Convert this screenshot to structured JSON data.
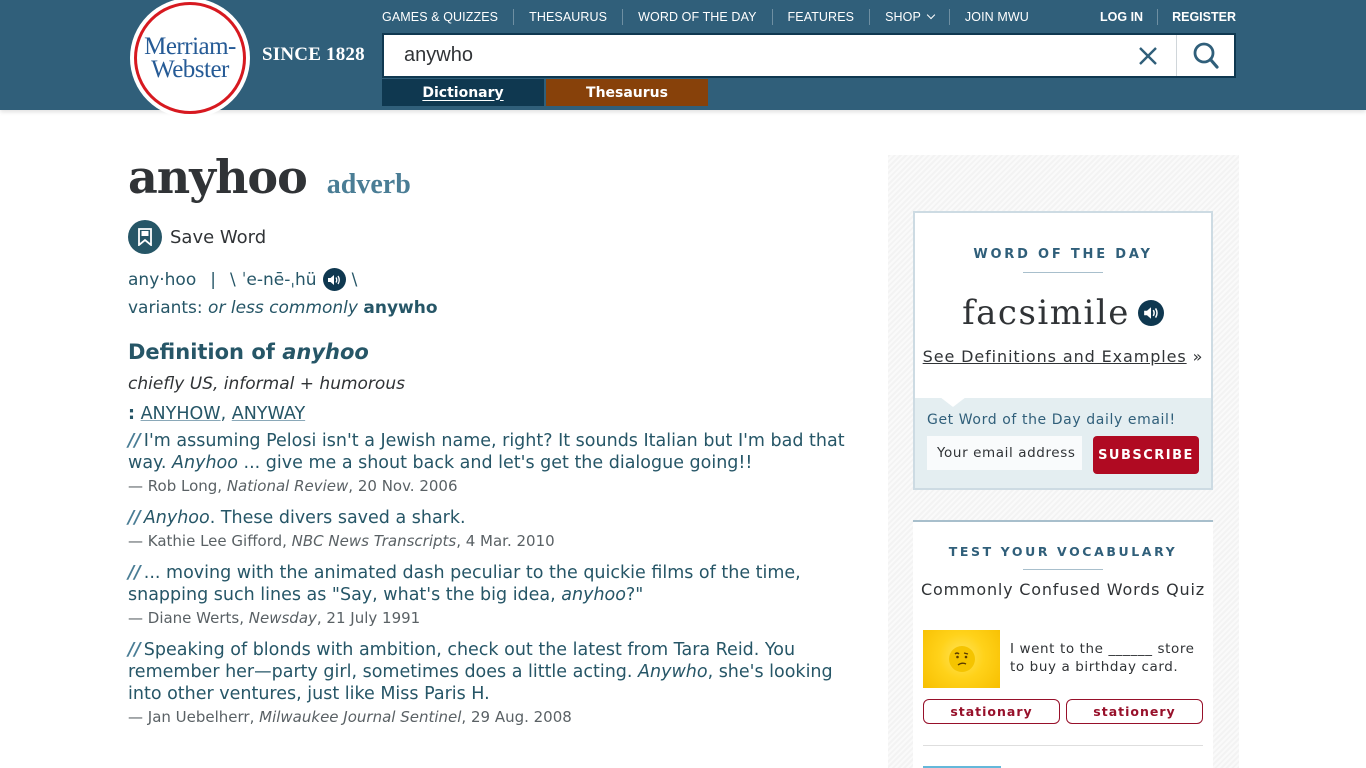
{
  "header": {
    "logo": {
      "line1": "Merriam-",
      "line2": "Webster"
    },
    "since": "SINCE 1828",
    "nav": [
      "GAMES & QUIZZES",
      "THESAURUS",
      "WORD OF THE DAY",
      "FEATURES",
      "SHOP",
      "JOIN MWU"
    ],
    "auth": {
      "login": "LOG IN",
      "register": "REGISTER"
    },
    "search": {
      "value": "anywho"
    },
    "tabs": {
      "dictionary": "Dictionary",
      "thesaurus": "Thesaurus"
    },
    "colors": {
      "bar": "#305f7a",
      "dictionary_tab": "#0f3850",
      "thesaurus_tab": "#87410a",
      "logo_ring": "#d71920"
    }
  },
  "entry": {
    "headword": "anyhoo",
    "pos": "adverb",
    "save_label": "Save Word",
    "syllables": "any·hoo",
    "separator": "|",
    "pron_open": "\\",
    "pronunciation": "ˈe-nē-ˌhü",
    "pron_close": "\\",
    "variants_label": "variants:",
    "variants_qualifier": "or less commonly",
    "variant": "anywho",
    "definition_heading_prefix": "Definition of",
    "definition_heading_word": "anyhoo",
    "usage_label": "chiefly US, informal + humorous",
    "sense_colon": ":",
    "sense_links": [
      "ANYHOW",
      "ANYWAY"
    ],
    "sense_comma": ",",
    "examples": [
      {
        "mark": "//",
        "before": "I'm assuming Pelosi isn't a Jewish name, right? It sounds Italian but I'm bad that way. ",
        "italic": "Anyhoo",
        "after": " ... give me a shout back and let's get the dialogue going!!",
        "author": "— Rob Long, ",
        "source": "National Review",
        "date": ", 20 Nov. 2006"
      },
      {
        "mark": "//",
        "before": "",
        "italic": "Anyhoo",
        "after": ". These divers saved a shark.",
        "author": "— Kathie Lee Gifford, ",
        "source": "NBC News Transcripts",
        "date": ", 4 Mar. 2010"
      },
      {
        "mark": "//",
        "before": "... moving with the animated dash peculiar to the quickie films of the time, snapping such lines as \"Say, what's the big idea, ",
        "italic": "anyhoo",
        "after": "?\"",
        "author": "— Diane Werts, ",
        "source": "Newsday",
        "date": ", 21 July 1991"
      },
      {
        "mark": "//",
        "before": "Speaking of blonds with ambition, check out the latest from Tara Reid. You remember her—party girl, sometimes does a little acting. ",
        "italic": "Anywho",
        "after": ", she's looking into other ventures, just like Miss Paris H.",
        "author": "— Jan Uebelherr, ",
        "source": "Milwaukee Journal Sentinel",
        "date": ", 29 Aug. 2008"
      }
    ]
  },
  "sidebar": {
    "wod": {
      "heading": "WORD OF THE DAY",
      "word": "facsimile",
      "link": "See Definitions and Examples",
      "link_suffix": "»",
      "email_label": "Get Word of the Day daily email!",
      "email_placeholder": "Your email address",
      "subscribe": "SUBSCRIBE"
    },
    "quiz": {
      "heading": "TEST YOUR VOCABULARY",
      "title": "Commonly Confused Words Quiz",
      "question": "I went to the ______ store to buy a birthday card.",
      "options": [
        "stationary",
        "stationery"
      ]
    }
  }
}
